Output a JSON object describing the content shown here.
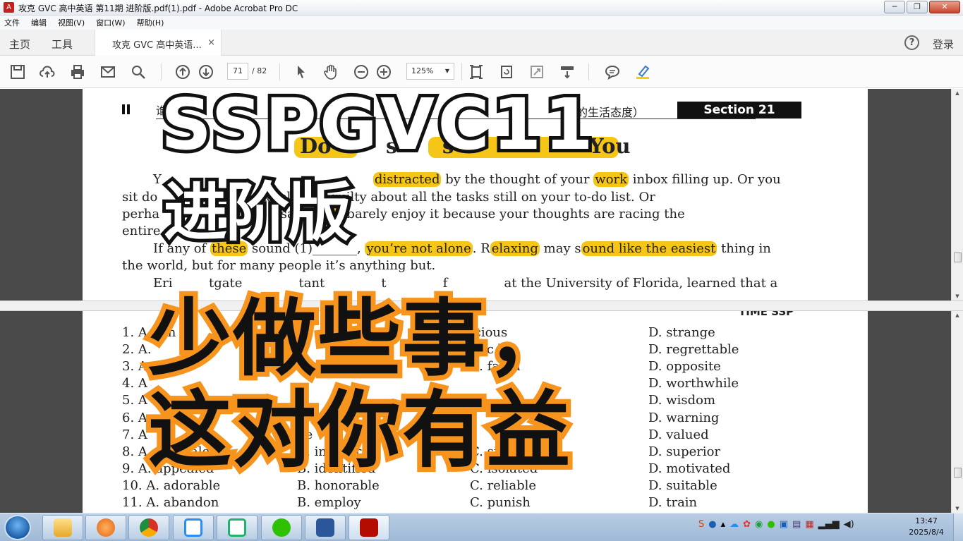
{
  "window": {
    "title": "攻克 GVC 高中英语 第11期 进阶版.pdf(1).pdf - Adobe Acrobat Pro DC",
    "min": "─",
    "max": "❐",
    "close": "✕"
  },
  "menu": [
    "文件",
    "编辑",
    "视图(V)",
    "窗口(W)",
    "帮助(H)"
  ],
  "nav": {
    "home": "主页",
    "tools": "工具",
    "tab_label": "攻克 GVC 高中英语...",
    "tab_close": "×",
    "help": "?",
    "login": "登录"
  },
  "toolbar": {
    "page_current": "71",
    "page_total": "/ 82",
    "zoom": "125%",
    "zoom_arrow": "▼"
  },
  "page_top": {
    "header_left": "谁",
    "header_right": "的生活态度）",
    "section": "Section 21",
    "headline_a": "Do",
    "headline_b": "s",
    "headline_c": "s",
    "headline_d": "You",
    "lines": [
      {
        "pre": "Y",
        "mid1": "distracted",
        "mid1b": " by the thought of your ",
        "hl2": "work",
        "post": " inbox filling up. Or you"
      },
      {
        "text": "sit do                        diately feel guilty about all the tasks still on your to-do list. Or"
      },
      {
        "pre": "perha                              sage, ",
        "hl": "but",
        "post": " barely enjoy it because your thoughts are racing the"
      },
      {
        "text": "entire"
      },
      {
        "pre": "If any of ",
        "hl1": "these",
        "mid": " sound (1)_______, ",
        "hl2": "you’re not alone",
        "mid2": ". R",
        "hl3": "elaxing",
        "mid3": " may s",
        "hl4": "ound like the easiest",
        "post": " thing in"
      },
      {
        "text": "the world, but for many people it’s anything but."
      },
      {
        "text": "Eri         tgate              tant              t              f              at the University of Florida, learned that a"
      }
    ]
  },
  "page_bottom": {
    "header": "TIME  SSP",
    "options": [
      {
        "a": "1. A. fan",
        "b": "",
        "c": "icious",
        "d": "D. strange"
      },
      {
        "a": "2. A.",
        "b": "e",
        "c": "otic      le",
        "d": "D. regrettable"
      },
      {
        "a": "3. A.",
        "b": "isas",
        "c": "C. fanta",
        "d": "D. opposite"
      },
      {
        "a": "4. A",
        "b": "",
        "c": "",
        "d": "D. worthwhile"
      },
      {
        "a": "5. A",
        "b": "",
        "c": "",
        "d": "D. wisdom"
      },
      {
        "a": "6. A",
        "b": "n",
        "c": "",
        "d": "D. warning"
      },
      {
        "a": "7. A",
        "b": "ne",
        "c": "s",
        "d": "D. valued"
      },
      {
        "a": "8. A. equivalent",
        "b": "B. indiffere",
        "c": "C. similar",
        "d": "D. superior"
      },
      {
        "a": "9. A. appealed",
        "b": "B. identified",
        "c": "C. isolated",
        "d": "D. motivated"
      },
      {
        "a": "10. A. adorable",
        "b": "B. honorable",
        "c": "C. reliable",
        "d": "D. suitable"
      },
      {
        "a": "11. A. abandon",
        "b": "B. employ",
        "c": "C. punish",
        "d": "D. train"
      }
    ]
  },
  "overlay": {
    "code": "SSPGVC11",
    "level": "进阶版",
    "line1": "少做些事，",
    "line2": "这对你有益"
  },
  "taskbar": {
    "clock_time": "13:47",
    "clock_date": "2025/8/4"
  }
}
